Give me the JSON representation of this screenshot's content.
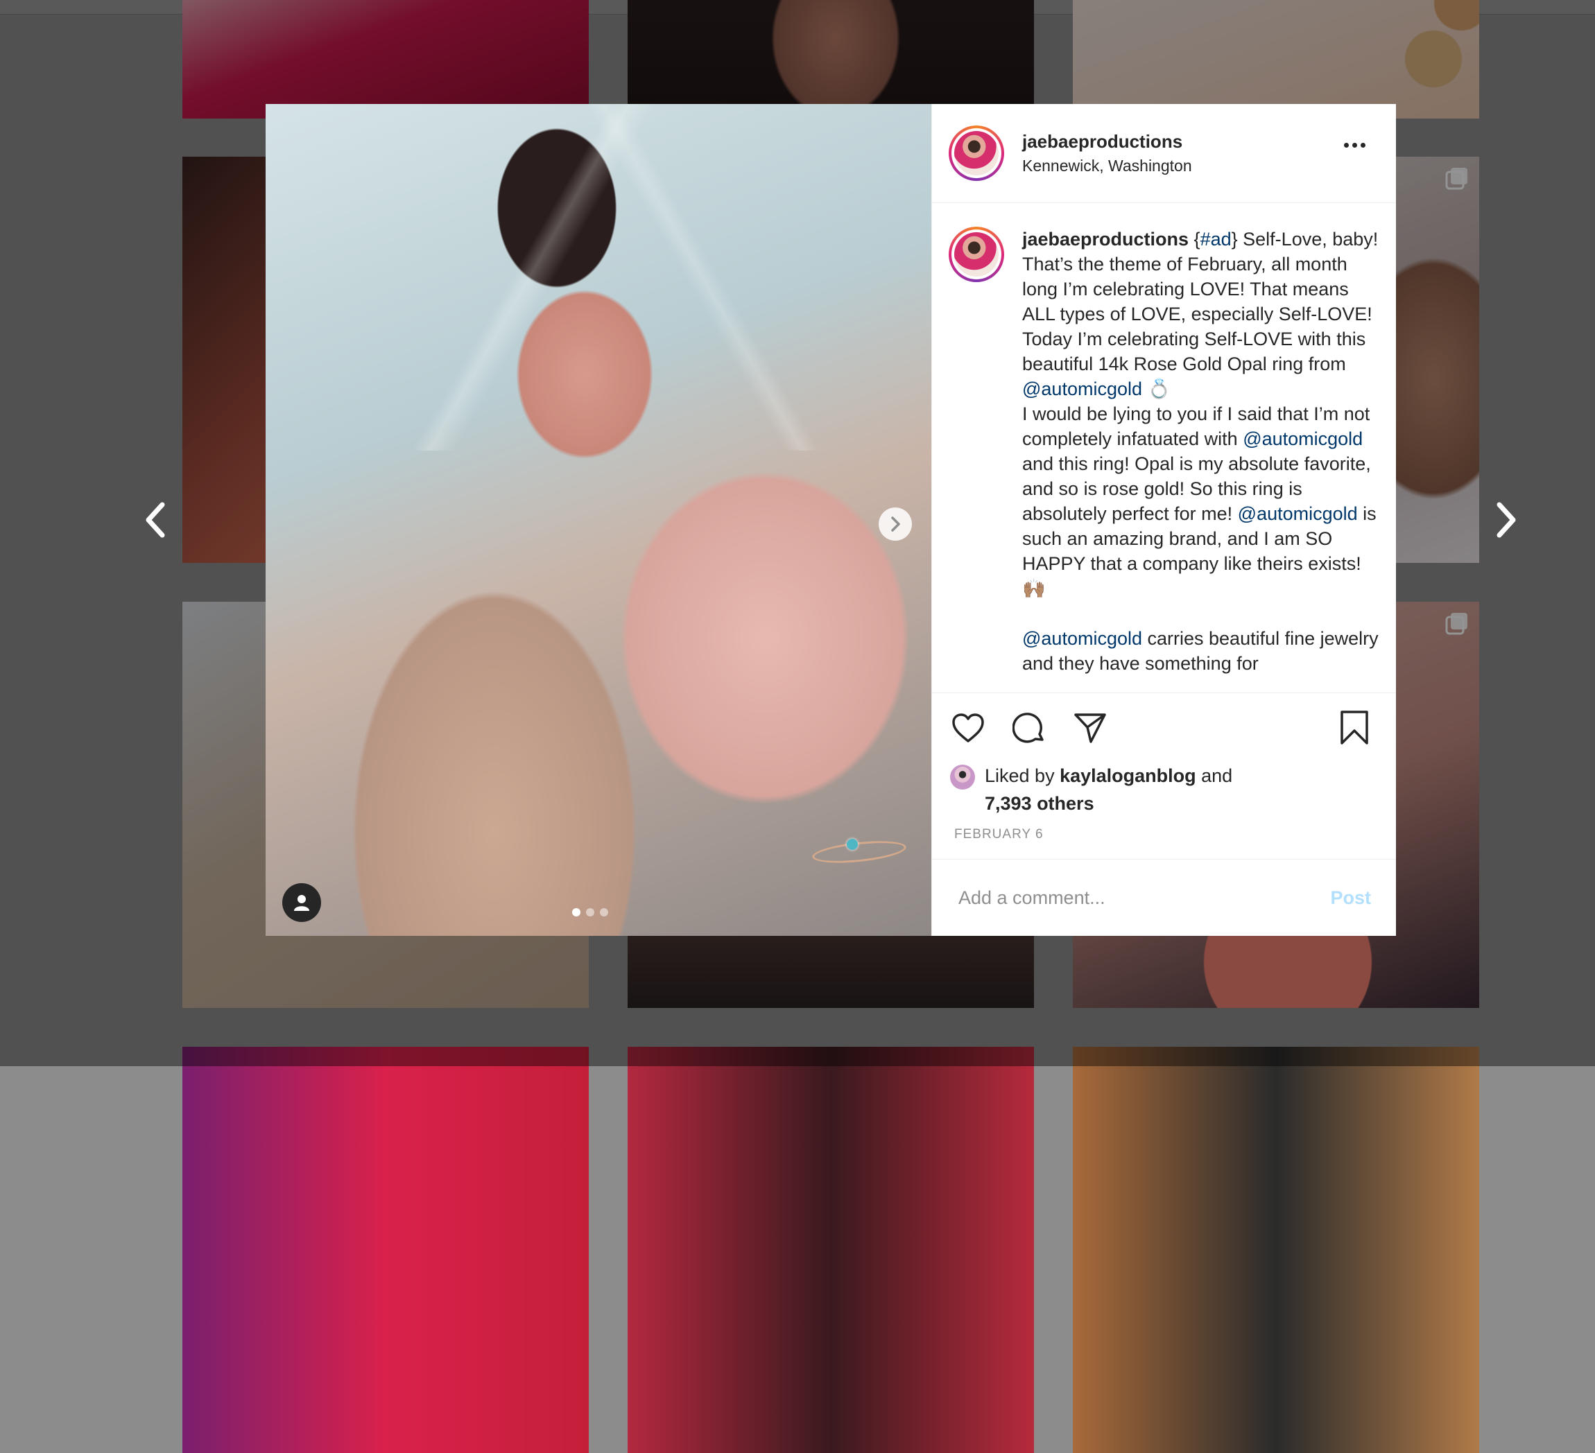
{
  "post": {
    "username": "jaebaeproductions",
    "location": "Kennewick, Washington",
    "caption_segments": [
      {
        "type": "user",
        "text": "jaebaeproductions"
      },
      {
        "type": "text",
        "text": " {"
      },
      {
        "type": "mention",
        "text": "#ad"
      },
      {
        "type": "text",
        "text": "} Self-Love, baby! That’s the theme of February, all month long I’m celebrating LOVE! That means ALL types of LOVE, especially Self-LOVE! Today I’m celebrating Self-LOVE with this beautiful 14k Rose Gold Opal ring from "
      },
      {
        "type": "mention",
        "text": "@automicgold"
      },
      {
        "type": "text",
        "text": " 💍"
      },
      {
        "type": "break"
      },
      {
        "type": "text",
        "text": "I would be lying to you if I said that I’m not completely infatuated with "
      },
      {
        "type": "mention",
        "text": "@automicgold"
      },
      {
        "type": "text",
        "text": " and this ring! Opal is my absolute favorite, and so is rose gold! So this ring is absolutely perfect for me! "
      },
      {
        "type": "mention",
        "text": "@automicgold"
      },
      {
        "type": "text",
        "text": " is such an amazing brand, and I am SO HAPPY that a company like theirs exists! 🙌🏽"
      },
      {
        "type": "blank"
      },
      {
        "type": "mention",
        "text": "@automicgold"
      },
      {
        "type": "text",
        "text": " carries beautiful fine jewelry and they have something for"
      }
    ],
    "likes": {
      "prefix": "Liked by ",
      "liker": "kaylaloganblog",
      "suffix": " and",
      "others": "7,393 others"
    },
    "date": "FEBRUARY 6",
    "comment_placeholder": "Add a comment...",
    "post_button": "Post",
    "carousel": {
      "count": 3,
      "active_index": 0
    }
  },
  "icons": {
    "prev": "chevron-left-icon",
    "next": "chevron-right-icon",
    "more": "more-options-icon",
    "like": "heart-icon",
    "comment": "comment-bubble-icon",
    "share": "paper-plane-icon",
    "save": "bookmark-icon",
    "tag": "user-tag-icon",
    "multi": "multiple-posts-icon"
  },
  "colors": {
    "mention": "#00376b",
    "post_button_disabled": "#b2dffc",
    "overlay": "rgba(0,0,0,0.42)"
  }
}
